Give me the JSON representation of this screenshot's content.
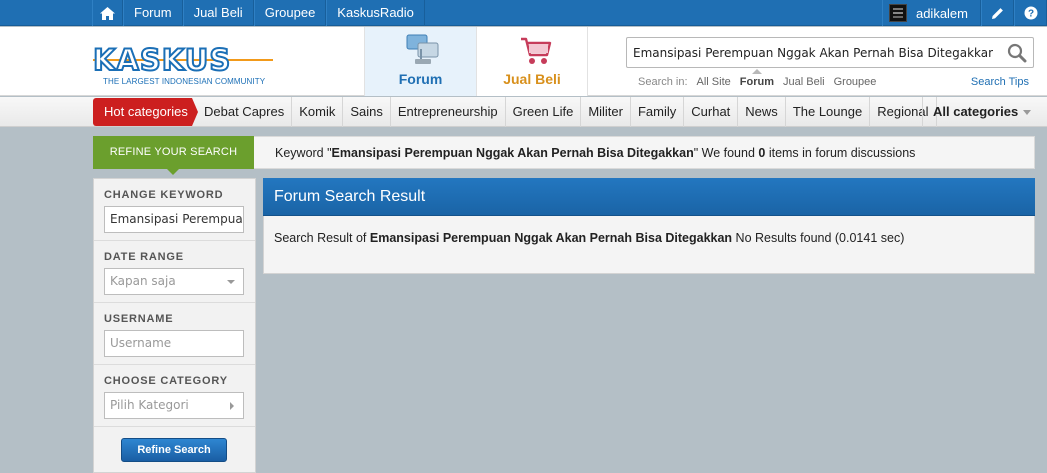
{
  "topbar": {
    "home_icon": "home-icon",
    "nav": [
      "Forum",
      "Jual Beli",
      "Groupee",
      "KaskusRadio"
    ],
    "username": "adikalem",
    "edit_icon": "pencil-icon",
    "help_icon": "help-icon"
  },
  "header": {
    "logo_text": "KASKUS",
    "logo_tagline": "THE LARGEST INDONESIAN COMMUNITY",
    "tabs": [
      {
        "label": "Forum",
        "icon": "forum-icon",
        "active": true,
        "color": "#1f6fb3"
      },
      {
        "label": "Jual Beli",
        "icon": "cart-icon",
        "active": false,
        "color": "#d8901c"
      }
    ],
    "search": {
      "value": "Emansipasi Perempuan Nggak Akan Pernah Bisa Ditegakkan",
      "search_in_label": "Search in:",
      "options": [
        "All Site",
        "Forum",
        "Jual Beli",
        "Groupee"
      ],
      "active_option": "Forum",
      "tips": "Search Tips"
    }
  },
  "categories": {
    "hot": "Hot categories",
    "items": [
      "Debat Capres",
      "Komik",
      "Sains",
      "Entrepreneurship",
      "Green Life",
      "Militer",
      "Family",
      "Curhat",
      "News",
      "The Lounge",
      "Regional"
    ],
    "all": "All categories"
  },
  "refine": {
    "tag": "REFINE YOUR SEARCH",
    "msg_prefix": "Keyword \"",
    "keyword": "Emansipasi Perempuan Nggak Akan Pernah Bisa Ditegakkan",
    "msg_mid": "\" We found ",
    "count": "0",
    "msg_suffix": " items in forum discussions"
  },
  "sidebar": {
    "keyword_label": "CHANGE KEYWORD",
    "keyword_value": "Emansipasi Perempuan Nggak Akan Pernah Bisa Ditegakkan",
    "date_label": "DATE RANGE",
    "date_value": "Kapan saja",
    "username_label": "USERNAME",
    "username_placeholder": "Username",
    "category_label": "CHOOSE CATEGORY",
    "category_value": "Pilih Kategori",
    "button": "Refine Search"
  },
  "result": {
    "title": "Forum Search Result",
    "prefix": "Search Result of ",
    "keyword": "Emansipasi Perempuan Nggak Akan Pernah Bisa Ditegakkan",
    "suffix": " No Results found (0.0141 sec)"
  },
  "colors": {
    "primary": "#1f6fb3",
    "accent_orange": "#d8901c",
    "hot_red": "#cc1f1f",
    "refine_green": "#6b9f2d"
  }
}
